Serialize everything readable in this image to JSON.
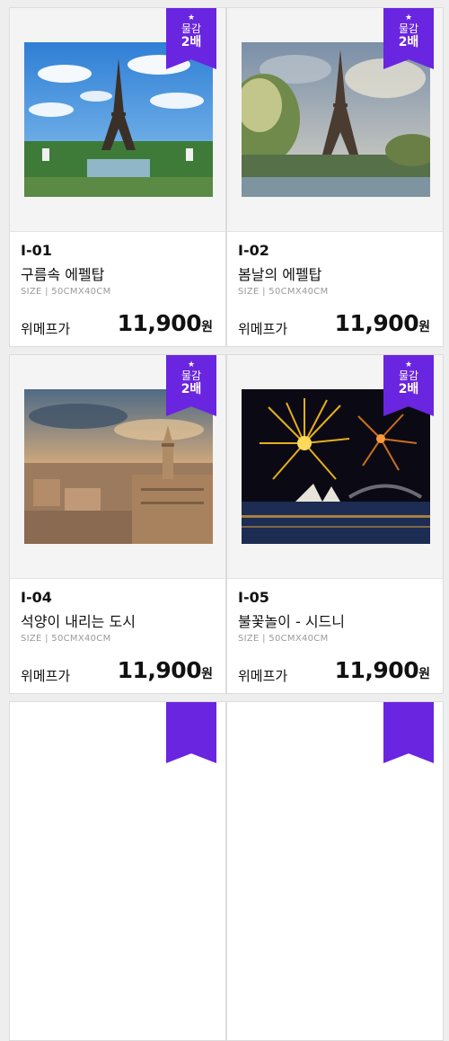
{
  "badge": {
    "line1": "물감",
    "line2": "2배",
    "star": "★"
  },
  "products": [
    {
      "code": "I-01",
      "title": "구름속 에펠탑",
      "size": "SIZE | 50CMX40CM",
      "price_label": "위메프가",
      "price": "11,900",
      "currency": "원",
      "image": "eiffel-tower-clouds-painting"
    },
    {
      "code": "I-02",
      "title": "봄날의 에펠탑",
      "size": "SIZE | 50CMX40CM",
      "price_label": "위메프가",
      "price": "11,900",
      "currency": "원",
      "image": "eiffel-tower-spring-painting"
    },
    {
      "code": "I-04",
      "title": "석양이 내리는 도시",
      "size": "SIZE | 50CMX40CM",
      "price_label": "위메프가",
      "price": "11,900",
      "currency": "원",
      "image": "sunset-city-painting"
    },
    {
      "code": "I-05",
      "title": "불꽃놀이 - 시드니",
      "size": "SIZE | 50CMX40CM",
      "price_label": "위메프가",
      "price": "11,900",
      "currency": "원",
      "image": "sydney-fireworks-painting"
    }
  ],
  "colors": {
    "badge": "#6a25e0",
    "background": "#eeeeee",
    "card": "#ffffff"
  }
}
